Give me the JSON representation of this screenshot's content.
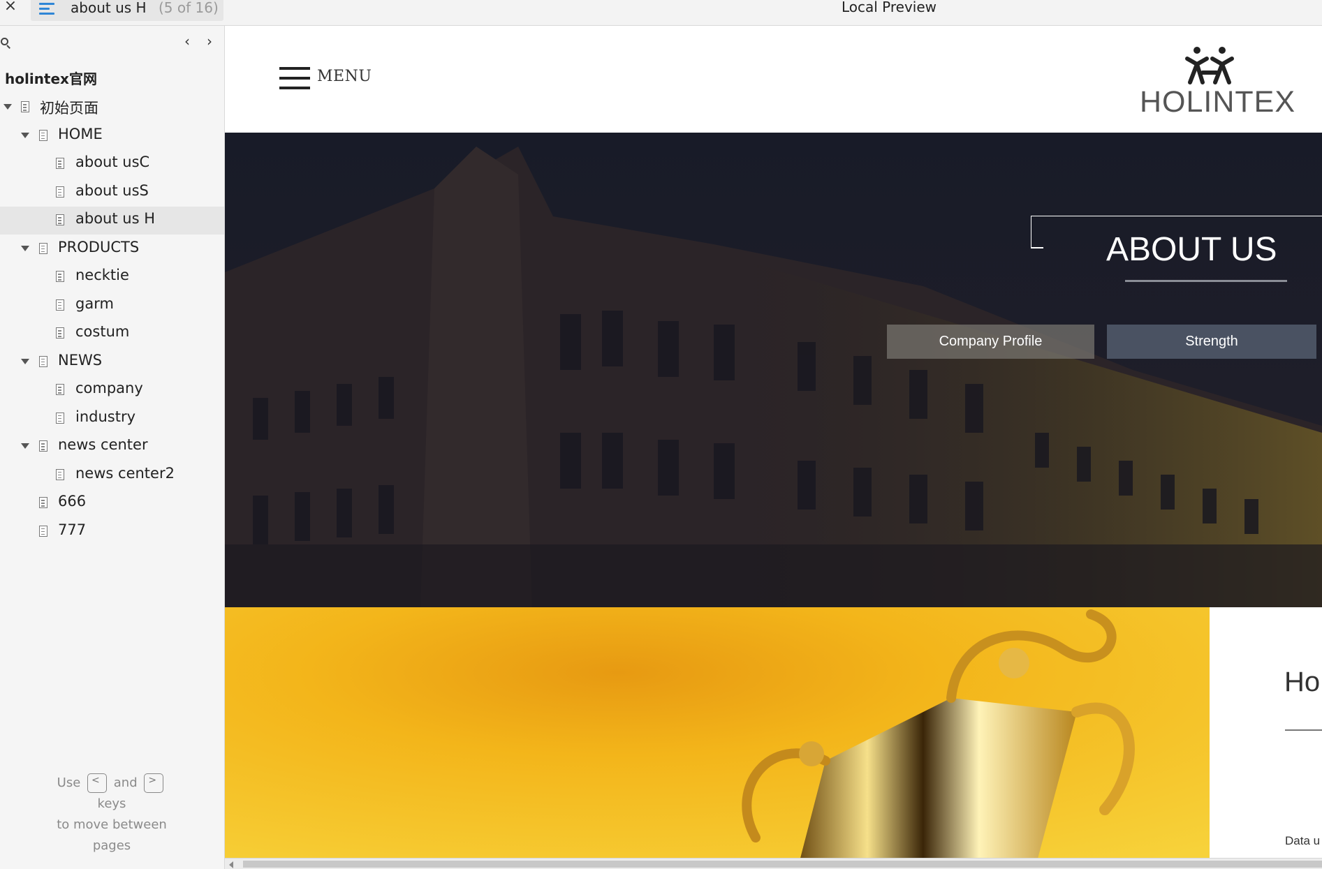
{
  "window": {
    "close_glyph": "×",
    "tab_title": "about us H",
    "tab_count": "(5 of 16)",
    "preview_title": "Local Preview"
  },
  "sidebar": {
    "site_title": "holintex官网",
    "nav_prev": "‹",
    "nav_next": "›",
    "tree": [
      {
        "label": "初始页面",
        "level": 0,
        "expanded": true
      },
      {
        "label": "HOME",
        "level": 1,
        "expanded": true
      },
      {
        "label": "about usC",
        "level": 2
      },
      {
        "label": "about usS",
        "level": 2
      },
      {
        "label": "about us H",
        "level": 2,
        "selected": true
      },
      {
        "label": "PRODUCTS",
        "level": 1,
        "expanded": true
      },
      {
        "label": "necktie",
        "level": 2
      },
      {
        "label": "garm",
        "level": 2
      },
      {
        "label": "costum",
        "level": 2
      },
      {
        "label": "NEWS",
        "level": 1,
        "expanded": true
      },
      {
        "label": "company",
        "level": 2
      },
      {
        "label": "industry",
        "level": 2
      },
      {
        "label": "news center",
        "level": 1,
        "expanded": true
      },
      {
        "label": "news center2",
        "level": 2
      },
      {
        "label": "666",
        "level": 1
      },
      {
        "label": "777",
        "level": 1
      }
    ],
    "hint": {
      "use": "Use",
      "and": "and",
      "keys": "keys",
      "to_move": "to move between",
      "pages": "pages",
      "key_prev": "<",
      "key_next": ">"
    }
  },
  "site": {
    "menu_label": "MENU",
    "logo_text": "HOLINTEX",
    "hero": {
      "title": "ABOUT US",
      "buttons": [
        "Company Profile",
        "Strength"
      ]
    },
    "info": {
      "heading": "Ho",
      "small_text": "Data u"
    }
  },
  "colors": {
    "tab_icon": "#2f86d6",
    "hero_overlay": "#1b1d27",
    "trophy_gold": "#f5c21b"
  }
}
